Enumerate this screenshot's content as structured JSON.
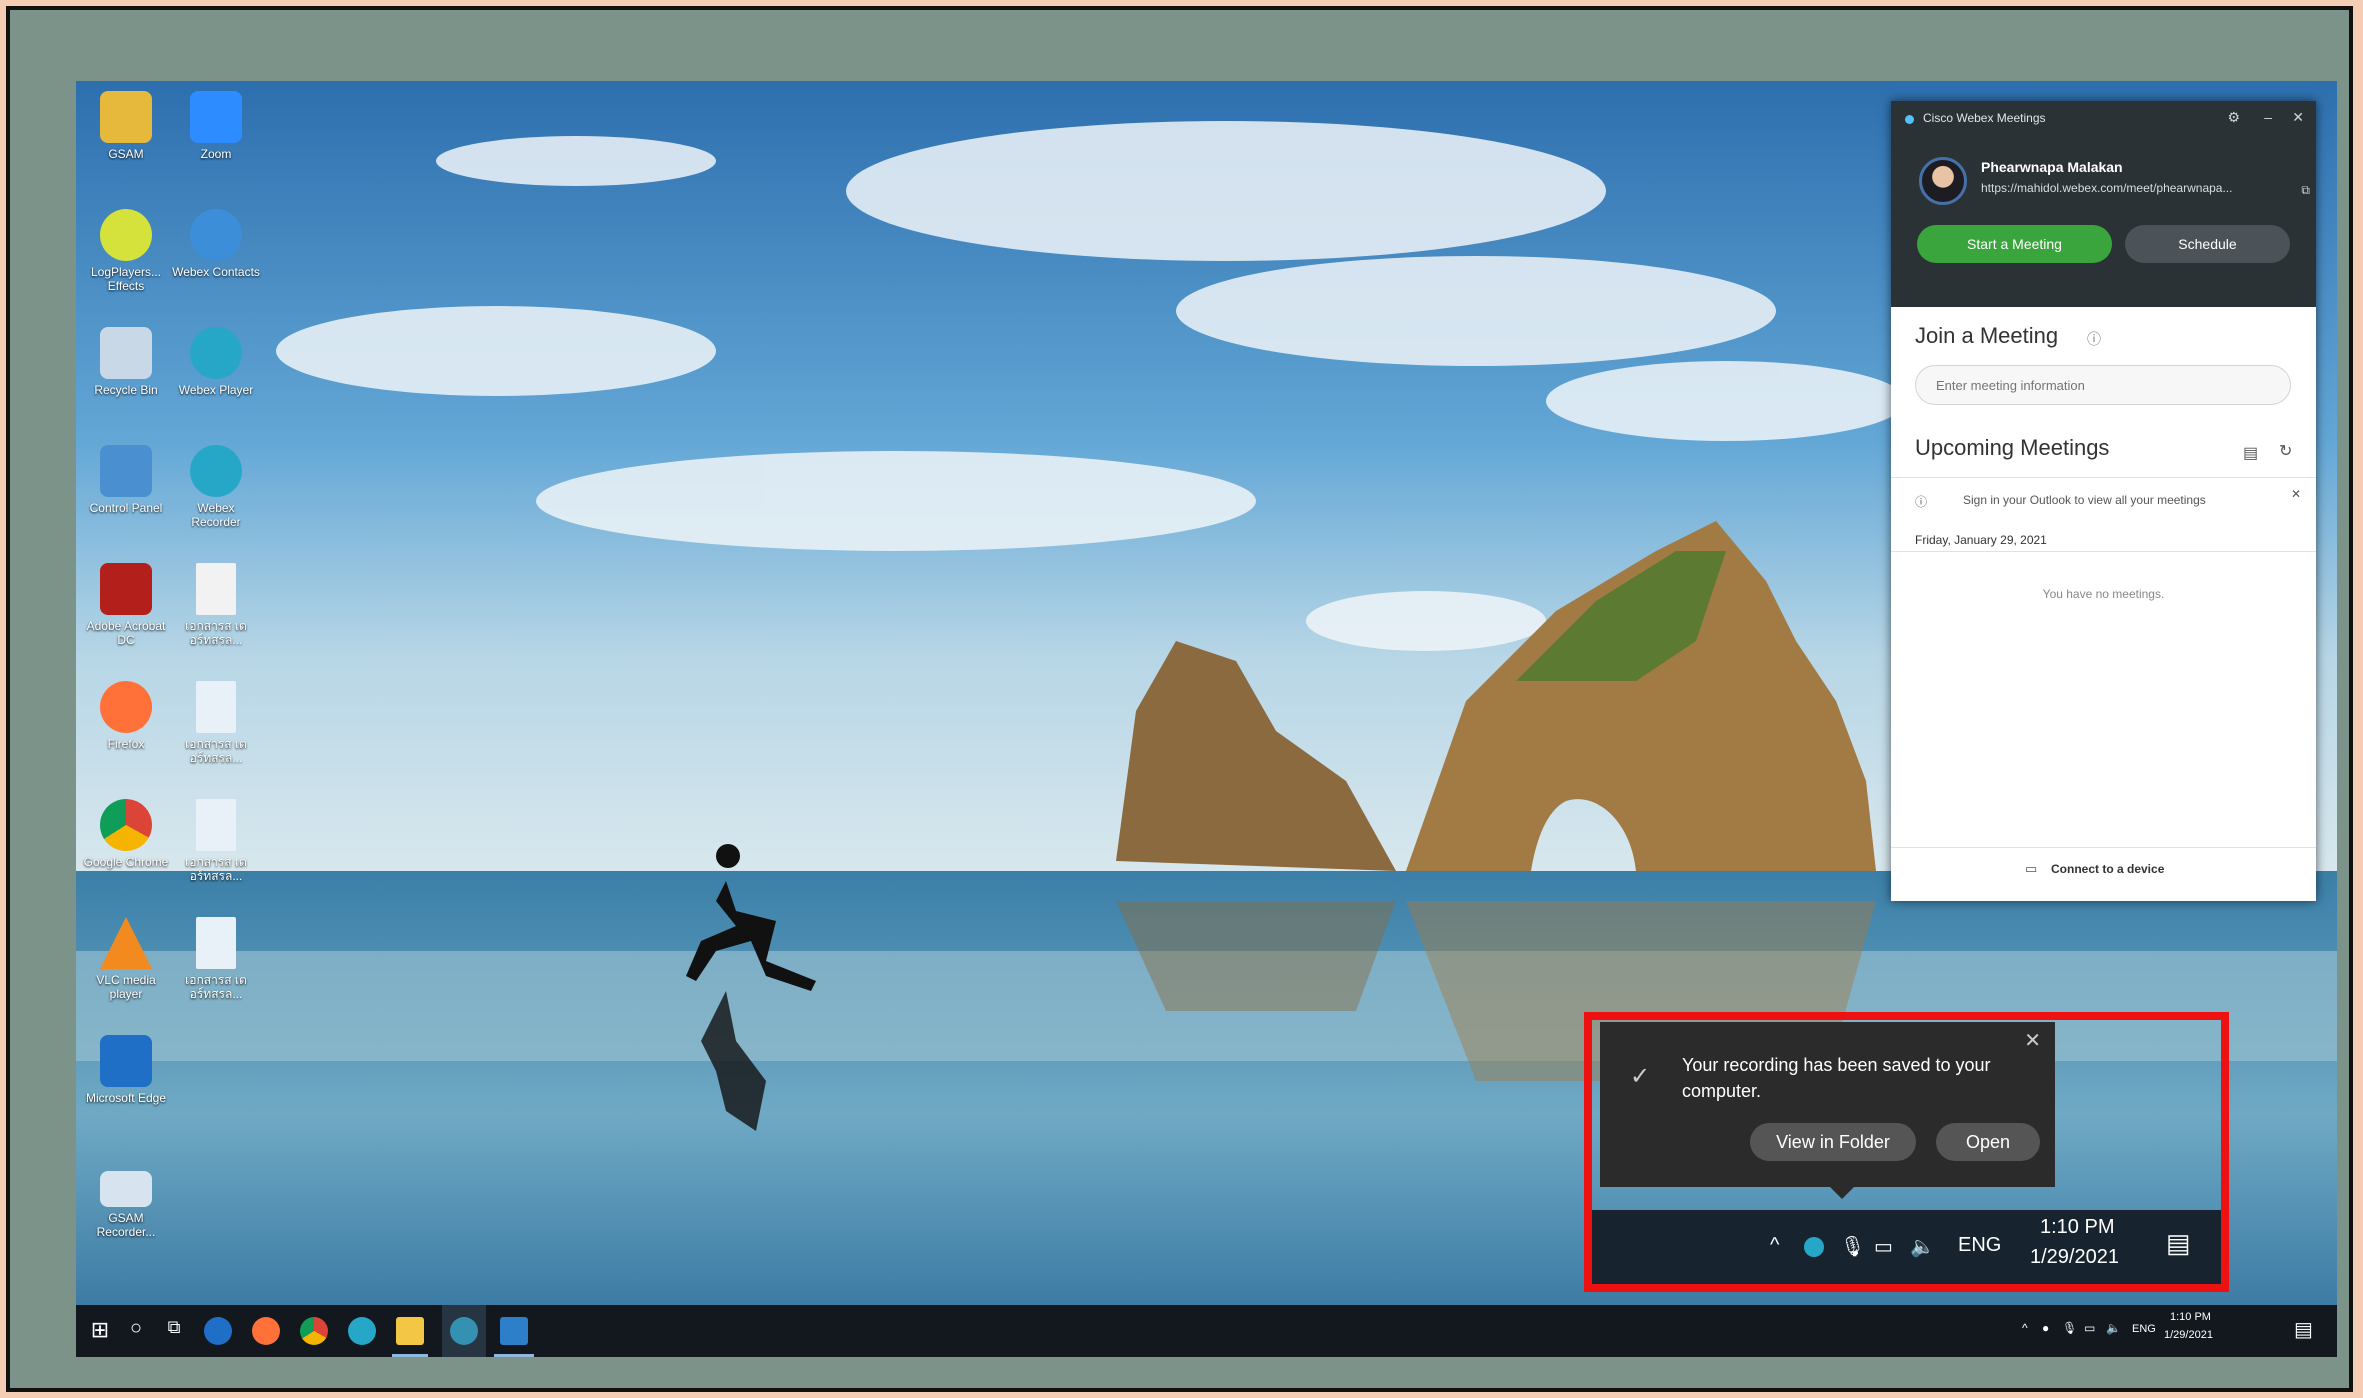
{
  "desktop_icons": [
    {
      "label": "GSAM",
      "icon": "user-folder-icon",
      "color": "#e6b93c"
    },
    {
      "label": "Zoom",
      "icon": "zoom-icon",
      "color": "#2d8cff"
    },
    {
      "label": "LogPlayers... Effects",
      "icon": "logplayer-icon",
      "color": "#d4e23b"
    },
    {
      "label": "Webex Contacts",
      "icon": "webex-contacts-icon",
      "color": "#3b8ed7"
    },
    {
      "label": "Recycle Bin",
      "icon": "recycle-bin-icon",
      "color": "#c9d8e6"
    },
    {
      "label": "Webex Player",
      "icon": "webex-player-icon",
      "color": "#27a7c8"
    },
    {
      "label": "Control Panel",
      "icon": "control-panel-icon",
      "color": "#4a8fd0"
    },
    {
      "label": "Webex Recorder",
      "icon": "webex-recorder-icon",
      "color": "#27a7c8"
    },
    {
      "label": "Adobe Acrobat DC",
      "icon": "adobe-acrobat-icon",
      "color": "#b3201b"
    },
    {
      "label": "เอกสารส เตอร์ทสรล...",
      "icon": "document-icon",
      "color": "#f2f2f2"
    },
    {
      "label": "Firefox",
      "icon": "firefox-icon",
      "color": "#ff7139"
    },
    {
      "label": "เอกสารส เตอร์ทสรล...",
      "icon": "recording-file-icon",
      "color": "#2d7fc9"
    },
    {
      "label": "Google Chrome",
      "icon": "chrome-icon",
      "color": "#2fa44f"
    },
    {
      "label": "เอกสารส เตอร์ทสรล...",
      "icon": "recording-file-icon",
      "color": "#2d7fc9"
    },
    {
      "label": "VLC media player",
      "icon": "vlc-icon",
      "color": "#f28a1f"
    },
    {
      "label": "เอกสารส เตอร์ทสรล...",
      "icon": "recording-file-icon",
      "color": "#2d7fc9"
    },
    {
      "label": "Microsoft Edge",
      "icon": "edge-icon",
      "color": "#1f6fc7"
    },
    {
      "label": "GSAM Recorder...",
      "icon": "monitor-icon",
      "color": "#d7e4ef"
    }
  ],
  "webex": {
    "window_title": "Cisco Webex Meetings",
    "user_name": "Phearwnapa Malakan",
    "meeting_url": "https://mahidol.webex.com/meet/phearwnapa...",
    "start_button": "Start a Meeting",
    "schedule_button": "Schedule",
    "join_heading": "Join a Meeting",
    "join_placeholder": "Enter meeting information",
    "upcoming_heading": "Upcoming Meetings",
    "outlook_notice": "Sign in your Outlook to view all your meetings",
    "date": "Friday, January 29, 2021",
    "no_meetings": "You have no meetings.",
    "connect_device": "Connect to a device"
  },
  "notification": {
    "message": "Your recording has been saved to your computer.",
    "view_folder_button": "View in Folder",
    "open_button": "Open"
  },
  "tray_zoomed": {
    "language": "ENG",
    "time": "1:10 PM",
    "date": "1/29/2021"
  },
  "taskbar": {
    "language": "ENG",
    "time": "1:10 PM",
    "date": "1/29/2021"
  }
}
